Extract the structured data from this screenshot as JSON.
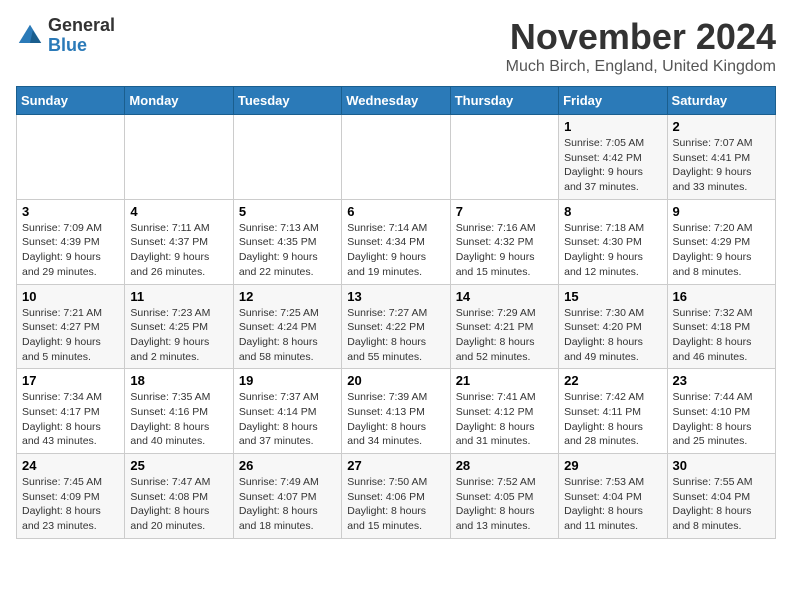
{
  "logo": {
    "line1": "General",
    "line2": "Blue"
  },
  "title": "November 2024",
  "location": "Much Birch, England, United Kingdom",
  "days_of_week": [
    "Sunday",
    "Monday",
    "Tuesday",
    "Wednesday",
    "Thursday",
    "Friday",
    "Saturday"
  ],
  "weeks": [
    [
      {
        "day": "",
        "info": ""
      },
      {
        "day": "",
        "info": ""
      },
      {
        "day": "",
        "info": ""
      },
      {
        "day": "",
        "info": ""
      },
      {
        "day": "",
        "info": ""
      },
      {
        "day": "1",
        "info": "Sunrise: 7:05 AM\nSunset: 4:42 PM\nDaylight: 9 hours and 37 minutes."
      },
      {
        "day": "2",
        "info": "Sunrise: 7:07 AM\nSunset: 4:41 PM\nDaylight: 9 hours and 33 minutes."
      }
    ],
    [
      {
        "day": "3",
        "info": "Sunrise: 7:09 AM\nSunset: 4:39 PM\nDaylight: 9 hours and 29 minutes."
      },
      {
        "day": "4",
        "info": "Sunrise: 7:11 AM\nSunset: 4:37 PM\nDaylight: 9 hours and 26 minutes."
      },
      {
        "day": "5",
        "info": "Sunrise: 7:13 AM\nSunset: 4:35 PM\nDaylight: 9 hours and 22 minutes."
      },
      {
        "day": "6",
        "info": "Sunrise: 7:14 AM\nSunset: 4:34 PM\nDaylight: 9 hours and 19 minutes."
      },
      {
        "day": "7",
        "info": "Sunrise: 7:16 AM\nSunset: 4:32 PM\nDaylight: 9 hours and 15 minutes."
      },
      {
        "day": "8",
        "info": "Sunrise: 7:18 AM\nSunset: 4:30 PM\nDaylight: 9 hours and 12 minutes."
      },
      {
        "day": "9",
        "info": "Sunrise: 7:20 AM\nSunset: 4:29 PM\nDaylight: 9 hours and 8 minutes."
      }
    ],
    [
      {
        "day": "10",
        "info": "Sunrise: 7:21 AM\nSunset: 4:27 PM\nDaylight: 9 hours and 5 minutes."
      },
      {
        "day": "11",
        "info": "Sunrise: 7:23 AM\nSunset: 4:25 PM\nDaylight: 9 hours and 2 minutes."
      },
      {
        "day": "12",
        "info": "Sunrise: 7:25 AM\nSunset: 4:24 PM\nDaylight: 8 hours and 58 minutes."
      },
      {
        "day": "13",
        "info": "Sunrise: 7:27 AM\nSunset: 4:22 PM\nDaylight: 8 hours and 55 minutes."
      },
      {
        "day": "14",
        "info": "Sunrise: 7:29 AM\nSunset: 4:21 PM\nDaylight: 8 hours and 52 minutes."
      },
      {
        "day": "15",
        "info": "Sunrise: 7:30 AM\nSunset: 4:20 PM\nDaylight: 8 hours and 49 minutes."
      },
      {
        "day": "16",
        "info": "Sunrise: 7:32 AM\nSunset: 4:18 PM\nDaylight: 8 hours and 46 minutes."
      }
    ],
    [
      {
        "day": "17",
        "info": "Sunrise: 7:34 AM\nSunset: 4:17 PM\nDaylight: 8 hours and 43 minutes."
      },
      {
        "day": "18",
        "info": "Sunrise: 7:35 AM\nSunset: 4:16 PM\nDaylight: 8 hours and 40 minutes."
      },
      {
        "day": "19",
        "info": "Sunrise: 7:37 AM\nSunset: 4:14 PM\nDaylight: 8 hours and 37 minutes."
      },
      {
        "day": "20",
        "info": "Sunrise: 7:39 AM\nSunset: 4:13 PM\nDaylight: 8 hours and 34 minutes."
      },
      {
        "day": "21",
        "info": "Sunrise: 7:41 AM\nSunset: 4:12 PM\nDaylight: 8 hours and 31 minutes."
      },
      {
        "day": "22",
        "info": "Sunrise: 7:42 AM\nSunset: 4:11 PM\nDaylight: 8 hours and 28 minutes."
      },
      {
        "day": "23",
        "info": "Sunrise: 7:44 AM\nSunset: 4:10 PM\nDaylight: 8 hours and 25 minutes."
      }
    ],
    [
      {
        "day": "24",
        "info": "Sunrise: 7:45 AM\nSunset: 4:09 PM\nDaylight: 8 hours and 23 minutes."
      },
      {
        "day": "25",
        "info": "Sunrise: 7:47 AM\nSunset: 4:08 PM\nDaylight: 8 hours and 20 minutes."
      },
      {
        "day": "26",
        "info": "Sunrise: 7:49 AM\nSunset: 4:07 PM\nDaylight: 8 hours and 18 minutes."
      },
      {
        "day": "27",
        "info": "Sunrise: 7:50 AM\nSunset: 4:06 PM\nDaylight: 8 hours and 15 minutes."
      },
      {
        "day": "28",
        "info": "Sunrise: 7:52 AM\nSunset: 4:05 PM\nDaylight: 8 hours and 13 minutes."
      },
      {
        "day": "29",
        "info": "Sunrise: 7:53 AM\nSunset: 4:04 PM\nDaylight: 8 hours and 11 minutes."
      },
      {
        "day": "30",
        "info": "Sunrise: 7:55 AM\nSunset: 4:04 PM\nDaylight: 8 hours and 8 minutes."
      }
    ]
  ]
}
